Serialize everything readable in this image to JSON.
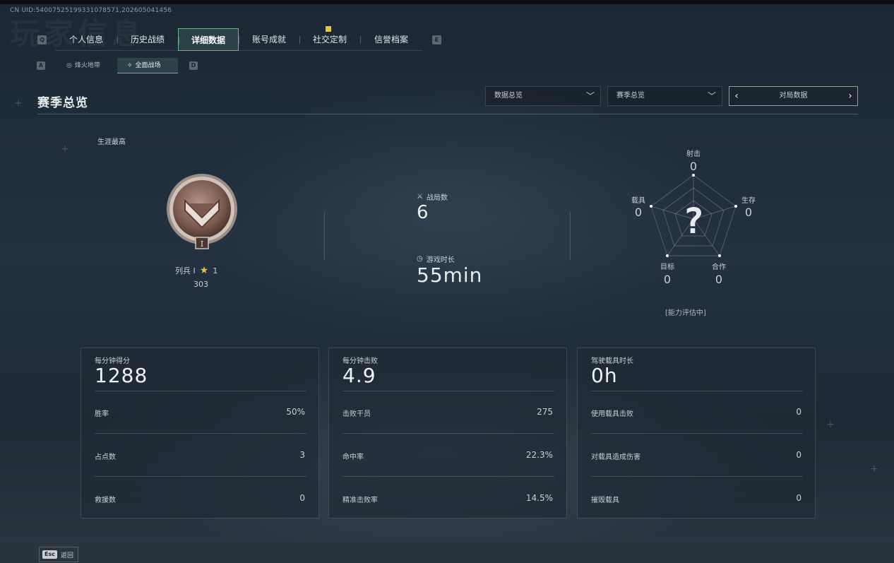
{
  "uid": "CN UID:54007525199331078571,202605041456",
  "bg_watermark": "玩家信息",
  "keys": {
    "prev_tab": "Q",
    "next_tab": "E",
    "prev_sub": "A",
    "next_sub": "D"
  },
  "tabs": [
    {
      "label": "个人信息"
    },
    {
      "label": "历史战绩"
    },
    {
      "label": "详细数据",
      "active": true
    },
    {
      "label": "账号成就"
    },
    {
      "label": "社交定制",
      "notification": true
    },
    {
      "label": "信誉档案"
    }
  ],
  "subtabs": [
    {
      "label": "烽火地带",
      "icon": "crosshair-icon"
    },
    {
      "label": "全面战场",
      "icon": "wings-icon",
      "active": true
    }
  ],
  "section_title": "赛季总览",
  "dropdowns": {
    "data": "数据总览",
    "season": "赛季总览"
  },
  "pager_label": "对局数据",
  "career": {
    "label": "生涯最高",
    "rank_name": "列兵 I",
    "stars": "1",
    "score": "303",
    "badge_numeral": "I"
  },
  "summary": {
    "matches_label": "战局数",
    "matches_value": "6",
    "playtime_label": "游戏时长",
    "playtime_value": "55min"
  },
  "radar": {
    "shoot_label": "射击",
    "shoot_value": "0",
    "survive_label": "生存",
    "survive_value": "0",
    "coop_label": "合作",
    "coop_value": "0",
    "objective_label": "目标",
    "objective_value": "0",
    "vehicle_label": "载具",
    "vehicle_value": "0",
    "center_mark": "?",
    "note": "[能力评估中]"
  },
  "cards": [
    {
      "head_label": "每分钟得分",
      "head_value": "1288",
      "rows": [
        {
          "label": "胜率",
          "value": "50%"
        },
        {
          "label": "占点数",
          "value": "3"
        },
        {
          "label": "救援数",
          "value": "0"
        }
      ]
    },
    {
      "head_label": "每分钟击败",
      "head_value": "4.9",
      "rows": [
        {
          "label": "击败干员",
          "value": "275"
        },
        {
          "label": "命中率",
          "value": "22.3%"
        },
        {
          "label": "精准击败率",
          "value": "14.5%"
        }
      ]
    },
    {
      "head_label": "驾驶载具时长",
      "head_value": "0h",
      "rows": [
        {
          "label": "使用载具击败",
          "value": "0"
        },
        {
          "label": "对载具造成伤害",
          "value": "0"
        },
        {
          "label": "摧毁载具",
          "value": "0"
        }
      ]
    }
  ],
  "footer": {
    "esc_key": "Esc",
    "esc_label": "返回"
  },
  "colors": {
    "accent": "#6fae8e",
    "notify": "#e8c14a",
    "badge": "#8a6a5c"
  }
}
